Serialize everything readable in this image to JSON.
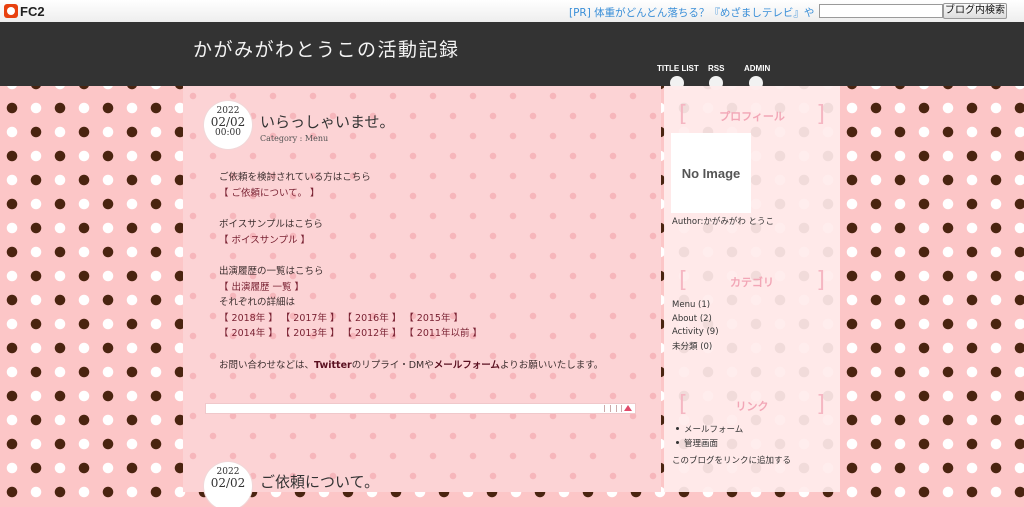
{
  "fc2_bar": {
    "logo_text": "FC2",
    "pr_link": "[PR] 体重がどんどん落ちる？『めざましテレビ』や『バイキン",
    "search_placeholder": "",
    "search_button": "ブログ内検索"
  },
  "header": {
    "blog_title": "かがみがわとうこの活動記録",
    "nav": [
      "TITLE LIST",
      "RSS",
      "ADMIN"
    ]
  },
  "posts": [
    {
      "date_year": "2022",
      "date_md": "02/02",
      "date_time": "00:00",
      "title": "いらっしゃいませ。",
      "category": "Category : Menu",
      "lines": {
        "l1": "ご依頼を検討されている方はこちら",
        "l2": "【 ご依頼について。 】",
        "l3": "ボイスサンプルはこちら",
        "l4": "【 ボイスサンプル 】",
        "l5": "出演履歴の一覧はこちら",
        "l6": "【 出演履歴 一覧 】",
        "l7": "それぞれの詳細は",
        "l8a": "【 2018年 】",
        "l8b": "【 2017年 】",
        "l8c": "【 2016年 】",
        "l8d": "【 2015年 】",
        "l9a": "【 2014年 】",
        "l9b": "【 2013年 】",
        "l9c": "【 2012年 】",
        "l9d": "【 2011年以前 】",
        "l10_pre": "お問い合わせなどは、",
        "l10_twitter": "Twitter",
        "l10_mid": "のリプライ・DMや",
        "l10_form": "メールフォーム",
        "l10_post": "よりお願いいたします。"
      }
    },
    {
      "date_year": "2022",
      "date_md": "02/02",
      "title": "ご依頼について。"
    }
  ],
  "sidebar": {
    "profile_title": "プロフィール",
    "no_image": "No Image",
    "author": "Author:かがみがわ とうこ",
    "category_title": "カテゴリ",
    "categories": [
      "Menu (1)",
      "About (2)",
      "Activity (9)",
      "未分類 (0)"
    ],
    "links_title": "リンク",
    "links": [
      "メールフォーム",
      "管理画面"
    ],
    "add_link": "このブログをリンクに追加する"
  },
  "colors": {
    "header_bg": "#333333",
    "page_pink": "#fcc6c7",
    "dot_brown": "#4a2410",
    "sidebar_heading": "#f2a6b6",
    "pr_link_blue": "#3a8fd8"
  }
}
